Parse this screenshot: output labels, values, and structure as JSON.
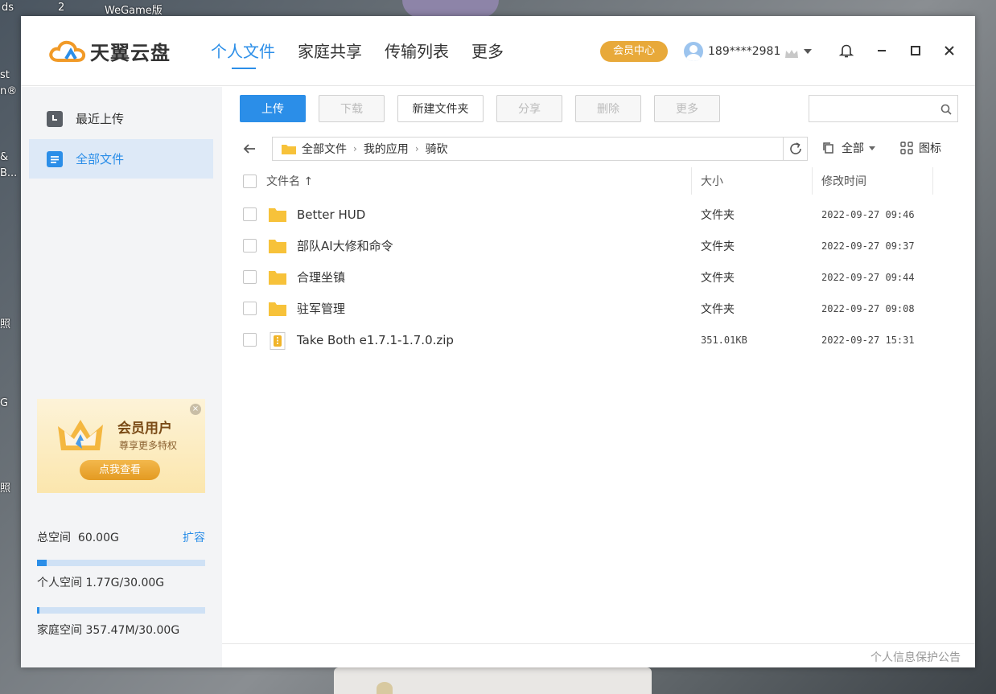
{
  "desktop": {
    "top_labels": [
      "ds",
      "2",
      "WeGame版"
    ],
    "left_labels": [
      "st",
      "n®",
      "&",
      "B...",
      "照",
      "G",
      "照"
    ]
  },
  "app": {
    "logo_text": "天翼云盘",
    "nav": [
      {
        "label": "个人文件",
        "active": true
      },
      {
        "label": "家庭共享",
        "active": false
      },
      {
        "label": "传输列表",
        "active": false
      },
      {
        "label": "更多",
        "active": false
      }
    ],
    "vip_center": "会员中心",
    "user_name": "189****2981"
  },
  "sidebar": {
    "items": [
      {
        "label": "最近上传",
        "active": false
      },
      {
        "label": "全部文件",
        "active": true
      }
    ],
    "promo": {
      "title": "会员用户",
      "subtitle": "尊享更多特权",
      "button": "点我查看",
      "close": "×"
    },
    "storage": {
      "total_label": "总空间",
      "total_value": "60.00G",
      "expand_label": "扩容",
      "personal_label": "个人空间",
      "personal_value": "1.77G/30.00G",
      "personal_fraction": 0.059,
      "family_label": "家庭空间",
      "family_value": "357.47M/30.00G",
      "family_fraction": 0.012
    }
  },
  "toolbar": {
    "upload": "上传",
    "download": "下载",
    "new_folder": "新建文件夹",
    "share": "分享",
    "delete": "删除",
    "more": "更多",
    "search_value": ""
  },
  "path": {
    "crumbs": [
      "全部文件",
      "我的应用",
      "骑砍"
    ],
    "filter_label": "全部",
    "view_label": "图标"
  },
  "table": {
    "headers": {
      "name": "文件名 ↑",
      "size": "大小",
      "time": "修改时间"
    },
    "rows": [
      {
        "name": "Better HUD",
        "size": "文件夹",
        "time": "2022-09-27 09:46",
        "type": "folder"
      },
      {
        "name": "部队AI大修和命令",
        "size": "文件夹",
        "time": "2022-09-27 09:37",
        "type": "folder"
      },
      {
        "name": "合理坐镇",
        "size": "文件夹",
        "time": "2022-09-27 09:44",
        "type": "folder"
      },
      {
        "name": "驻军管理",
        "size": "文件夹",
        "time": "2022-09-27 09:08",
        "type": "folder"
      },
      {
        "name": "Take Both e1.7.1-1.7.0.zip",
        "size": "351.01KB",
        "time": "2022-09-27 15:31",
        "type": "zip"
      }
    ]
  },
  "footer": {
    "privacy": "个人信息保护公告"
  },
  "colors": {
    "accent": "#2b8ee8",
    "vip": "#e8a93a",
    "folder": "#f7c23a"
  }
}
